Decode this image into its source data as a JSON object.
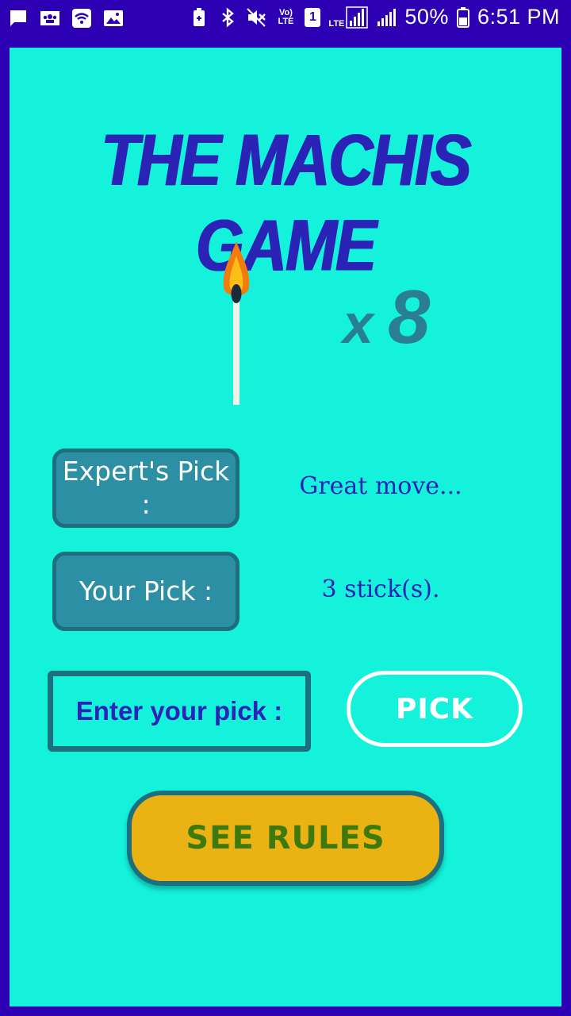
{
  "status_bar": {
    "battery": "50%",
    "time": "6:51 PM",
    "volte": "Vo) LTE",
    "sim": "1",
    "lte": "LTE",
    "icons_left": [
      "message-icon",
      "contacts-icon",
      "wifi-call-icon",
      "image-icon"
    ],
    "icons_right": [
      "battery-saver-icon",
      "bluetooth-icon",
      "mute-icon",
      "volte-icon",
      "sim-1-icon",
      "lte-signal-icon",
      "signal-icon",
      "battery-icon"
    ]
  },
  "game": {
    "title": "THE MACHIS GAME",
    "stick_icon": "matchstick-icon",
    "count_prefix": "x",
    "count": "8"
  },
  "expert": {
    "label": "Expert's Pick :",
    "message": "Great move..."
  },
  "player": {
    "label": "Your Pick :",
    "message": "3 stick(s)."
  },
  "input": {
    "placeholder": "Enter your pick :"
  },
  "buttons": {
    "pick": "PICK",
    "rules": "SEE RULES"
  },
  "colors": {
    "status_bar": "#2d00b3",
    "background": "#14f2dc",
    "title": "#2a23b5",
    "label_box": "#2d8fa3",
    "rules_button": "#ebb214",
    "rules_text": "#3d7a0b"
  }
}
